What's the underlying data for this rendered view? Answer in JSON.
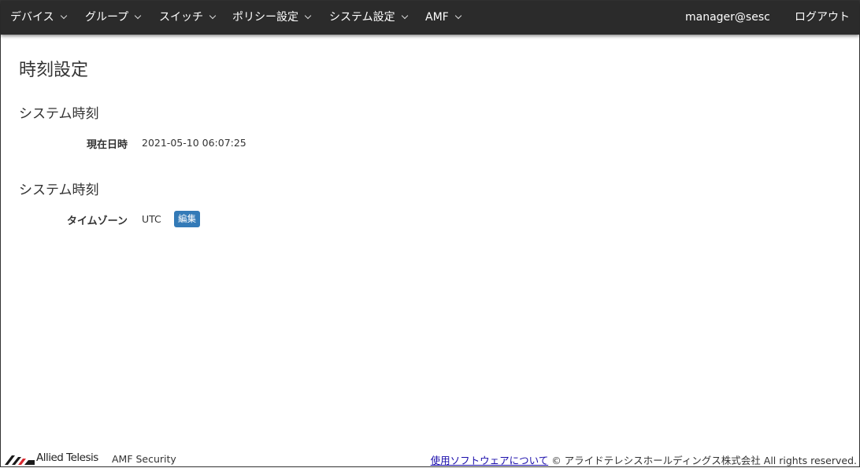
{
  "nav": {
    "devices": "デバイス",
    "groups": "グループ",
    "switches": "スイッチ",
    "policy": "ポリシー設定",
    "system": "システム設定",
    "amf": "AMF",
    "user": "manager@sesc",
    "logout": "ログアウト"
  },
  "page": {
    "title": "時刻設定"
  },
  "sections": [
    {
      "title": "システム時刻",
      "label": "現在日時",
      "value": "2021-05-10 06:07:25"
    },
    {
      "title": "システム時刻",
      "label": "タイムゾーン",
      "value": "UTC",
      "button": "編集"
    }
  ],
  "footer": {
    "brand": "Allied Telesis",
    "product": "AMF Security",
    "software_link": "使用ソフトウェアについて",
    "copyright": "© アライドテレシスホールディングス株式会社 All rights reserved."
  },
  "colors": {
    "navbar": "#2b2b2b",
    "button": "#337ab7"
  }
}
